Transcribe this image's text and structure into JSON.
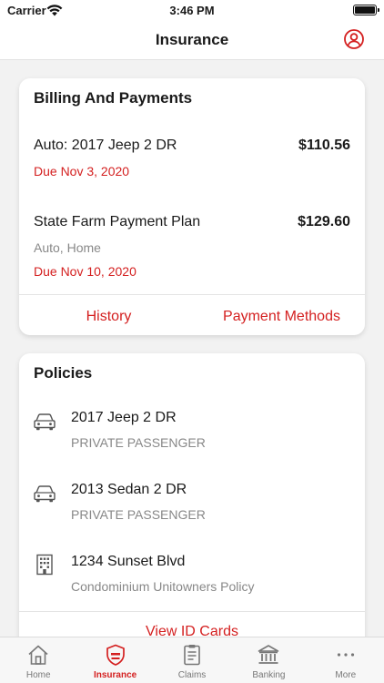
{
  "status_bar": {
    "carrier": "Carrier",
    "time": "3:46 PM"
  },
  "header": {
    "title": "Insurance",
    "profile_icon": "user-circle-icon"
  },
  "billing": {
    "title": "Billing And Payments",
    "items": [
      {
        "title": "Auto: 2017 Jeep 2 DR",
        "amount": "$110.56",
        "due": "Due Nov 3, 2020"
      },
      {
        "title": "State Farm Payment Plan",
        "subtitle": "Auto, Home",
        "amount": "$129.60",
        "due": "Due Nov 10, 2020"
      }
    ],
    "actions": {
      "history": "History",
      "payment_methods": "Payment Methods"
    }
  },
  "policies": {
    "title": "Policies",
    "items": [
      {
        "name": "2017 Jeep 2 DR",
        "type": "PRIVATE PASSENGER",
        "icon": "car-icon"
      },
      {
        "name": "2013 Sedan 2 DR",
        "type": "PRIVATE PASSENGER",
        "icon": "car-icon"
      },
      {
        "name": "1234 Sunset Blvd",
        "type": "Condominium Unitowners Policy",
        "icon": "building-icon"
      }
    ],
    "view_id_cards": "View ID Cards"
  },
  "tabs": [
    {
      "label": "Home",
      "icon": "home-icon",
      "active": false
    },
    {
      "label": "Insurance",
      "icon": "shield-icon",
      "active": true
    },
    {
      "label": "Claims",
      "icon": "clipboard-icon",
      "active": false
    },
    {
      "label": "Banking",
      "icon": "bank-icon",
      "active": false
    },
    {
      "label": "More",
      "icon": "more-dots-icon",
      "active": false
    }
  ],
  "colors": {
    "accent": "#d42020",
    "text": "#1a1a1a",
    "secondary_text": "#888888",
    "background": "#f2f2f2"
  }
}
